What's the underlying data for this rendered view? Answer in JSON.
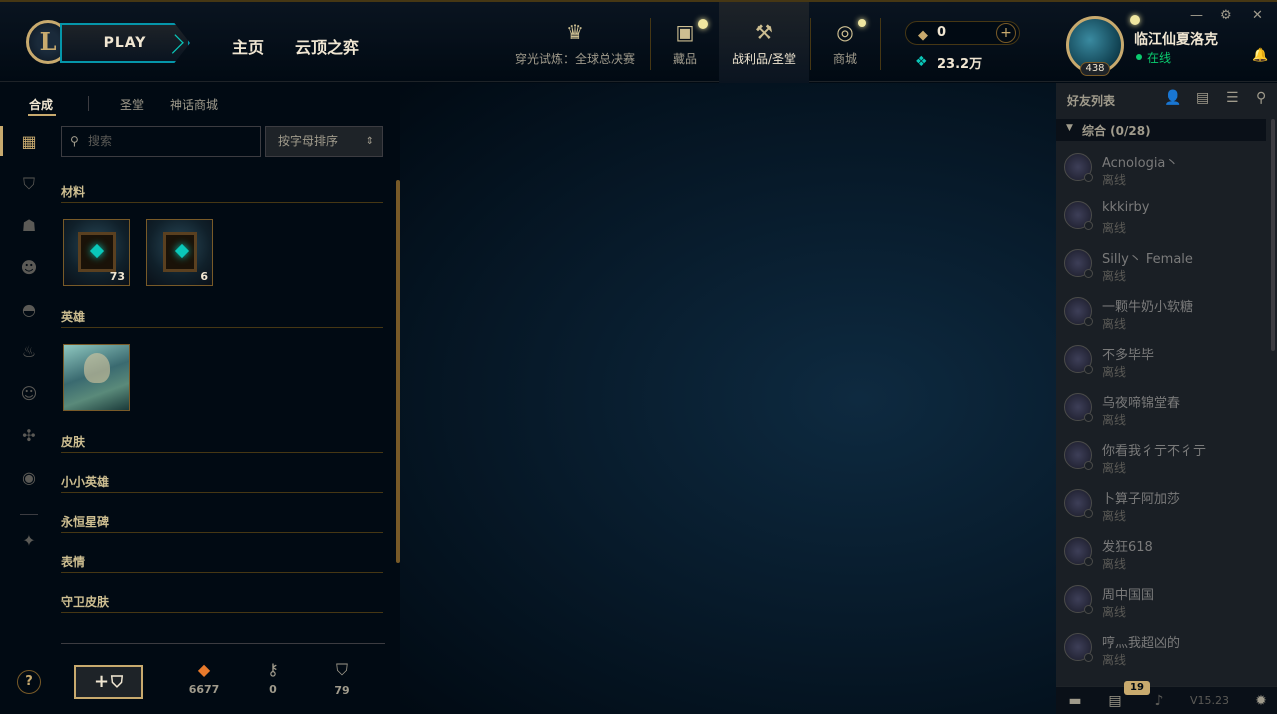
{
  "topbar": {
    "play_label": "PLAY",
    "logo_letter": "L",
    "nav_home": "主页",
    "nav_tft": "云顶之弈",
    "event_label": "穿光试炼：全球总决赛",
    "collection_label": "藏品",
    "loot_label": "战利品/圣堂",
    "store_label": "商城",
    "rp_value": "0",
    "be_value": "23.2万",
    "profile_name": "临江仙夏洛克",
    "profile_status": "在线",
    "level": "438"
  },
  "loot": {
    "tabs": [
      "合成",
      "圣堂",
      "神话商城"
    ],
    "search_placeholder": "搜索",
    "sort_label": "按字母排序",
    "sections": {
      "materials": "材料",
      "champions": "英雄",
      "skins": "皮肤",
      "little_legends": "小小英雄",
      "eternals": "永恒星碑",
      "emotes": "表情",
      "ward_skins": "守卫皮肤"
    },
    "material_items": [
      {
        "count": "73"
      },
      {
        "count": "6"
      }
    ],
    "stats": {
      "orange_essence": "6677",
      "keys": "0",
      "chests": "79"
    },
    "help_label": "?",
    "craft_label": "+"
  },
  "friends": {
    "title": "好友列表",
    "group_label": "综合 (0/28)",
    "list": [
      {
        "name": "Acnologia丶",
        "status": "离线"
      },
      {
        "name": "kkkirby",
        "status": "离线"
      },
      {
        "name": "Silly丶 Female",
        "status": "离线"
      },
      {
        "name": "一颗牛奶小软糖",
        "status": "离线"
      },
      {
        "name": "不多毕毕",
        "status": "离线"
      },
      {
        "name": "乌夜啼锦堂春",
        "status": "离线"
      },
      {
        "name": "你看我彳亍不彳亍",
        "status": "离线"
      },
      {
        "name": "卜算子阿加莎",
        "status": "离线"
      },
      {
        "name": "发狂618",
        "status": "离线"
      },
      {
        "name": "周中国国",
        "status": "离线"
      },
      {
        "name": "哼灬我超凶的",
        "status": "离线"
      }
    ],
    "badge_count": "19",
    "version": "V15.23"
  }
}
